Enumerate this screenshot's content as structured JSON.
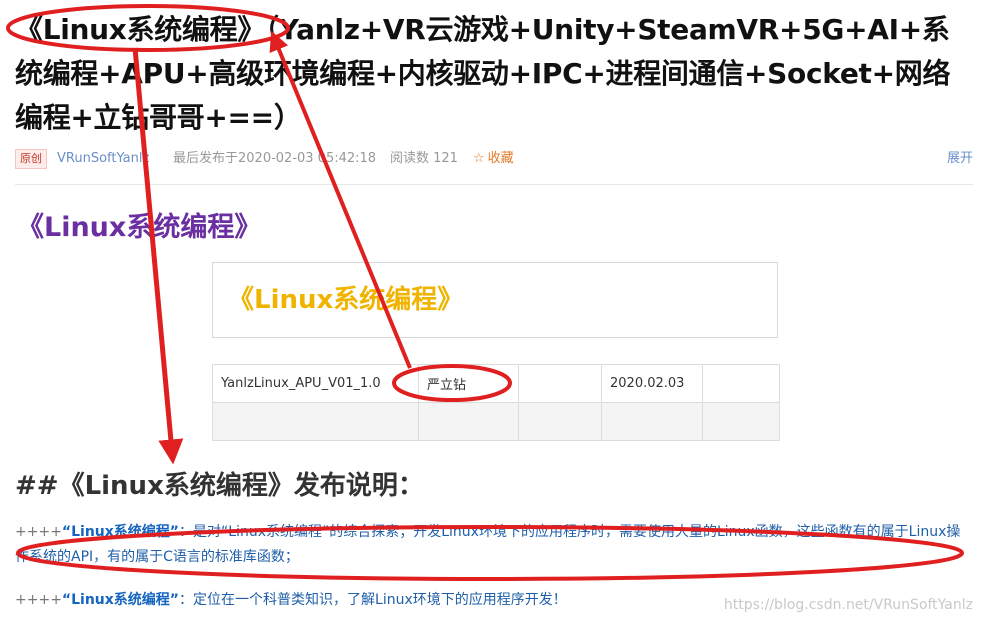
{
  "article": {
    "title": "《Linux系统编程》（Yanlz+VR云游戏+Unity+SteamVR+5G+AI+系统编程+APU+高级环境编程+内核驱动+IPC+进程间通信+Socket+网络编程+立钻哥哥+==）",
    "meta": {
      "badge": "原创",
      "author": "VRunSoftYanlz",
      "publish_time": "最后发布于2020-02-03 05:42:18",
      "reads": "阅读数 121",
      "collect": "收藏",
      "expand": "展开"
    }
  },
  "content": {
    "heading": "《Linux系统编程》",
    "box_title": "《Linux系统编程》",
    "version_table": {
      "rows": [
        [
          "YanlzLinux_APU_V01_1.0",
          "严立钻",
          "",
          "2020.02.03",
          ""
        ],
        [
          "",
          "",
          "",
          "",
          ""
        ]
      ]
    },
    "section_heading": "##《Linux系统编程》发布说明：",
    "para1": {
      "prefix": "++++",
      "keyword": "“Linux系统编程”",
      "text": "：是对“Linux系统编程”的综合探索；开发Linux环境下的应用程序时，需要使用大量的Linux函数，这些函数有的属于Linux操作系统的API，有的属于C语言的标准库函数；"
    },
    "para2": {
      "prefix": "++++",
      "keyword": "“Linux系统编程”",
      "text": "：定位在一个科普类知识，了解Linux环境下的应用程序开发！"
    }
  },
  "watermark": "https://blog.csdn.net/VRunSoftYanlz",
  "icons": {
    "collect": "star-icon"
  },
  "colors": {
    "annotation": "#e02020",
    "heading_purple": "#6a2fa0",
    "box_title_gold": "#f0b400",
    "link_blue": "#6b8fc8"
  }
}
